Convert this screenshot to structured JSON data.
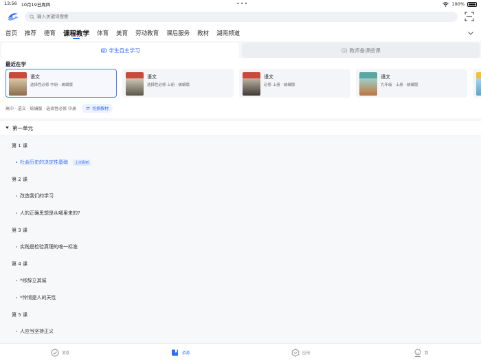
{
  "status": {
    "time": "13:56",
    "date": "10月19日周四",
    "battery": "100%"
  },
  "search": {
    "placeholder": "输入关键词搜索"
  },
  "nav": {
    "items": [
      "首页",
      "推荐",
      "德育",
      "课程教学",
      "体育",
      "美育",
      "劳动教育",
      "课后服务",
      "教材",
      "湖南频道"
    ],
    "active_index": 3
  },
  "mode_tabs": [
    {
      "label": "学生自主学习",
      "active": true,
      "icon": "student-icon"
    },
    {
      "label": "教师备课授课",
      "active": false,
      "icon": "teacher-icon"
    }
  ],
  "recent": {
    "title": "最近在学",
    "books": [
      {
        "name": "语文",
        "edition": "选择性必修 中册 · 统编版",
        "selected": true
      },
      {
        "name": "语文",
        "edition": "选择性必修 上册 · 统编版",
        "selected": false
      },
      {
        "name": "语文",
        "edition": "必修 上册 · 统编版",
        "selected": false
      },
      {
        "name": "语文",
        "edition": "九年级 · 上册 · 统编版",
        "selected": false
      }
    ],
    "colors": {
      "accent": "#2f6bff"
    }
  },
  "current_textbook": "高中 · 语文 · 统编版 · 选择性必修 中册",
  "switch_label": "切换教材",
  "unit": {
    "title": "第一单元",
    "icon": "caret-down-icon"
  },
  "lessons": [
    {
      "title": "第 1 课",
      "chapters": [
        {
          "label": "社会历史的决定性基础",
          "current": true,
          "badge": "上次看到"
        }
      ]
    },
    {
      "title": "第 2 课",
      "chapters": [
        {
          "label": "改造我们的学习"
        },
        {
          "label": "人的正确思想是从哪里来的?"
        }
      ]
    },
    {
      "title": "第 3 课",
      "chapters": [
        {
          "label": "实践是检验真理的唯一标准"
        }
      ]
    },
    {
      "title": "第 4 课",
      "chapters": [
        {
          "label": "*修辞立其诚"
        },
        {
          "label": "*怜悯是人的天性"
        }
      ]
    },
    {
      "title": "第 5 课",
      "chapters": [
        {
          "label": "人应当坚持正义"
        }
      ]
    }
  ],
  "tabbar": [
    {
      "label": "消息",
      "icon": "message-icon",
      "active": false
    },
    {
      "label": "资源",
      "icon": "book-icon",
      "active": true
    },
    {
      "label": "应用",
      "icon": "apps-icon",
      "active": false
    },
    {
      "label": "我",
      "icon": "profile-icon",
      "active": false
    }
  ]
}
